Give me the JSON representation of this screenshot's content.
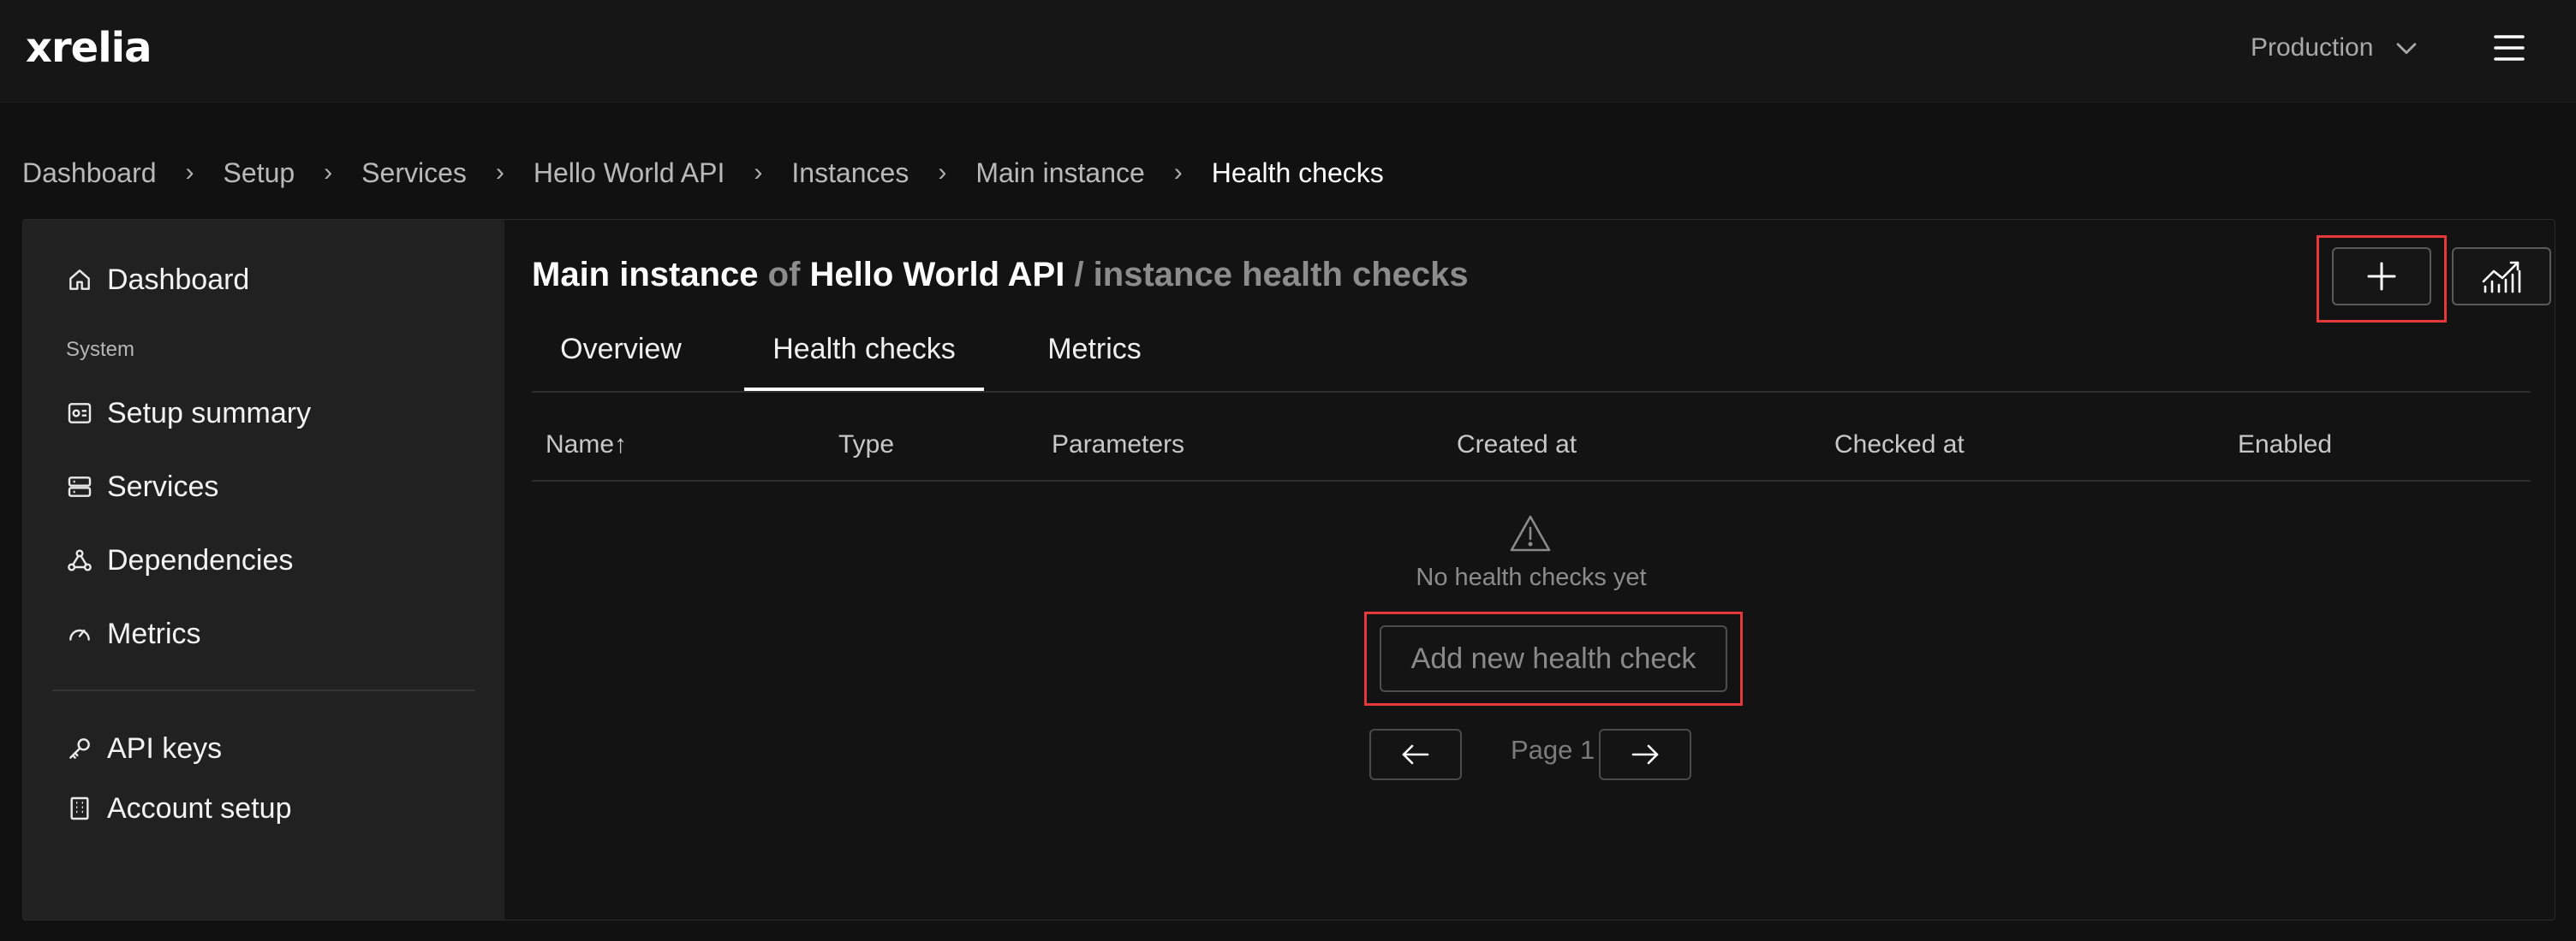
{
  "app": {
    "logo_text": "xrelia",
    "environment": "Production",
    "menu_icon": "hamburger-menu-icon"
  },
  "breadcrumb": [
    "Dashboard",
    "Setup",
    "Services",
    "Hello World API",
    "Instances",
    "Main instance",
    "Health checks"
  ],
  "breadcrumb_separator": "›",
  "sidebar": {
    "items_top": [
      {
        "label": "Dashboard",
        "icon": "home-icon"
      }
    ],
    "section_label": "System",
    "items_system": [
      {
        "label": "Setup summary",
        "icon": "setup-summary-icon"
      },
      {
        "label": "Services",
        "icon": "server-icon"
      },
      {
        "label": "Dependencies",
        "icon": "dependencies-icon"
      },
      {
        "label": "Metrics",
        "icon": "gauge-icon"
      }
    ],
    "items_bottom": [
      {
        "label": "API keys",
        "icon": "key-icon"
      },
      {
        "label": "Account setup",
        "icon": "building-icon"
      }
    ]
  },
  "page": {
    "title_instance": "Main instance",
    "title_of": "of",
    "title_service": "Hello World API",
    "title_suffix": "/ instance health checks"
  },
  "tabs": [
    {
      "label": "Overview",
      "active": false
    },
    {
      "label": "Health checks",
      "active": true
    },
    {
      "label": "Metrics",
      "active": false
    }
  ],
  "toolbar": {
    "add_icon": "plus-icon",
    "chart_icon": "line-chart-icon"
  },
  "table": {
    "columns": [
      "Name",
      "Type",
      "Parameters",
      "Created at",
      "Checked at",
      "Enabled"
    ],
    "sort_indicator": "↑",
    "empty_icon": "warning-icon",
    "empty_text": "No health checks yet",
    "add_button_label": "Add new health check"
  },
  "pagination": {
    "page_label": "Page 1",
    "prev_icon": "arrow-left-icon",
    "next_icon": "arrow-right-icon"
  },
  "colors": {
    "background": "#111111",
    "sidebar": "#212121",
    "highlight": "#e5383b"
  }
}
